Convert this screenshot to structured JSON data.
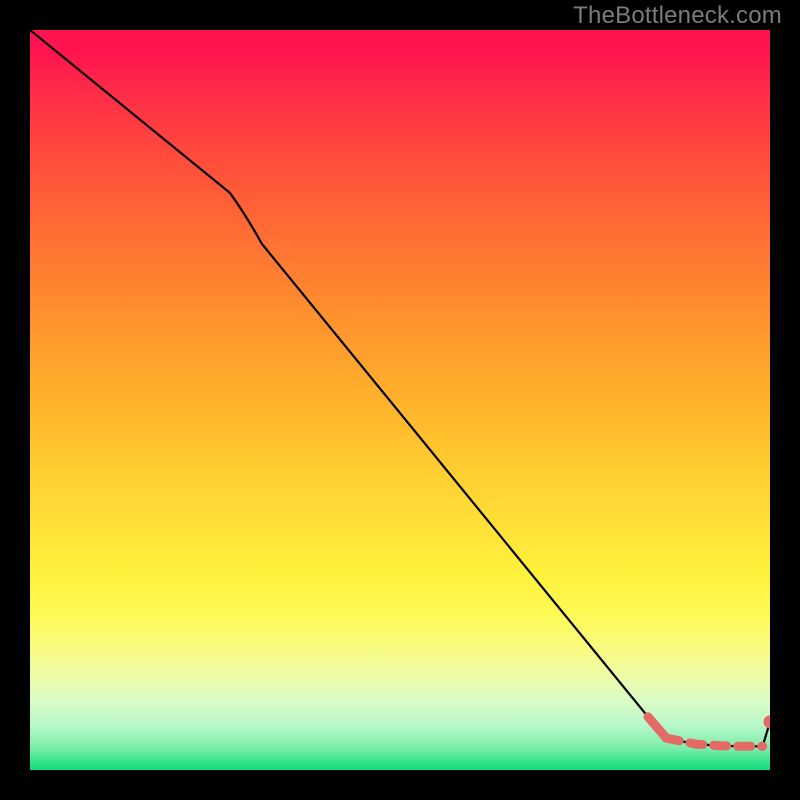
{
  "watermark": "TheBottleneck.com",
  "chart_data": {
    "type": "line",
    "title": "",
    "xlabel": "",
    "ylabel": "",
    "xlim": [
      0,
      100
    ],
    "ylim": [
      0,
      100
    ],
    "series": [
      {
        "name": "main-curve",
        "x": [
          0,
          27,
          83.5,
          86,
          90,
          93,
          96,
          99
        ],
        "y": [
          100,
          78,
          7.2,
          4.3,
          3.5,
          3.3,
          3.2,
          3.2
        ]
      },
      {
        "name": "tail-rise",
        "x": [
          99,
          100
        ],
        "y": [
          3.2,
          6.5
        ]
      },
      {
        "name": "highlight-fall",
        "x": [
          83.5,
          86
        ],
        "y": [
          7.2,
          4.3
        ]
      },
      {
        "name": "dashed-flat",
        "x": [
          86,
          99
        ],
        "y": [
          4.3,
          3.2
        ]
      },
      {
        "name": "end-marker",
        "x": [
          100
        ],
        "y": [
          6.5
        ]
      }
    ],
    "colors": {
      "curve": "#000000",
      "highlight": "#e46a66",
      "gradient_top": "#ff1450",
      "gradient_bottom": "#14d97d",
      "frame": "#000000"
    }
  }
}
